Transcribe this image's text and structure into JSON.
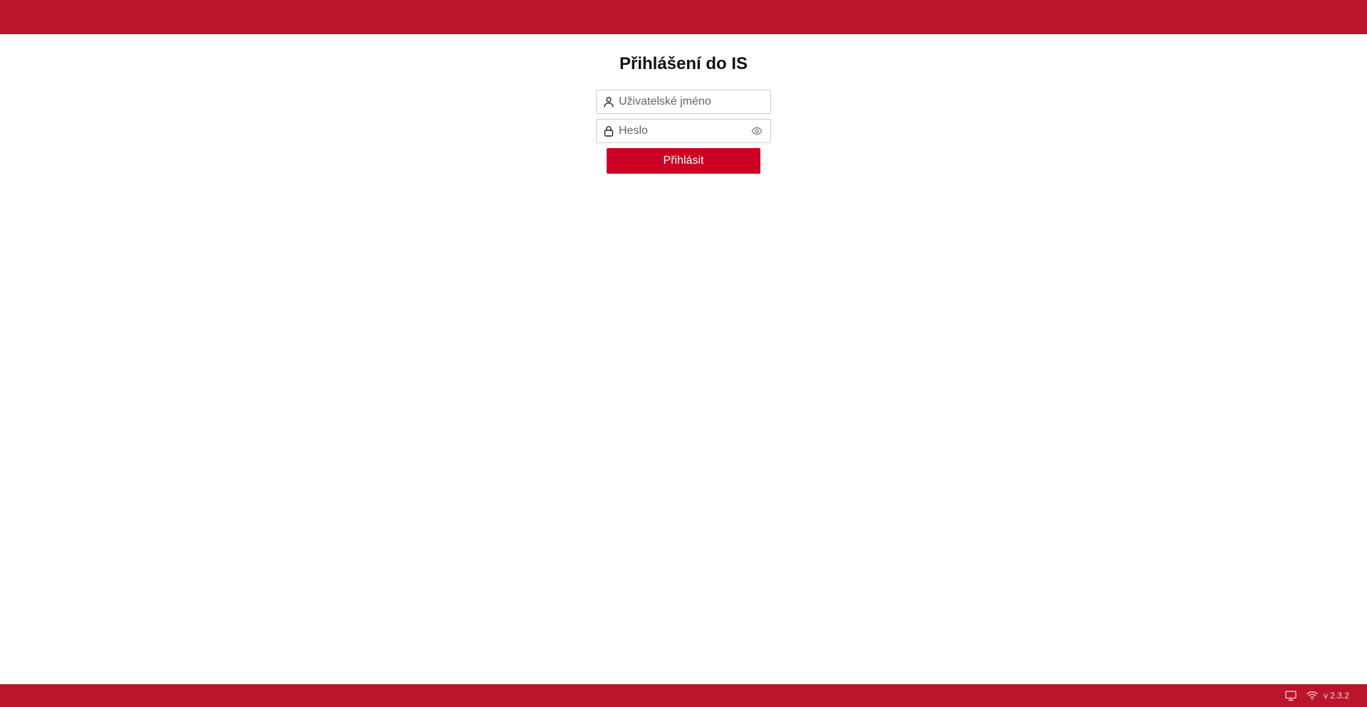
{
  "colors": {
    "brand_bar": "#bb142d",
    "primary_button": "#cc0022",
    "field_border": "#c9cdd2"
  },
  "login": {
    "title": "Přihlášení do IS",
    "username": {
      "icon": "user-icon",
      "placeholder": "Uživatelské jméno",
      "value": ""
    },
    "password": {
      "icon": "lock-icon",
      "placeholder": "Heslo",
      "value": "",
      "toggle_icon": "eye-icon"
    },
    "submit_label": "Přihlásit"
  },
  "footer": {
    "icons": [
      "monitor-icon",
      "wifi-icon"
    ],
    "version": "v 2.3.2"
  }
}
